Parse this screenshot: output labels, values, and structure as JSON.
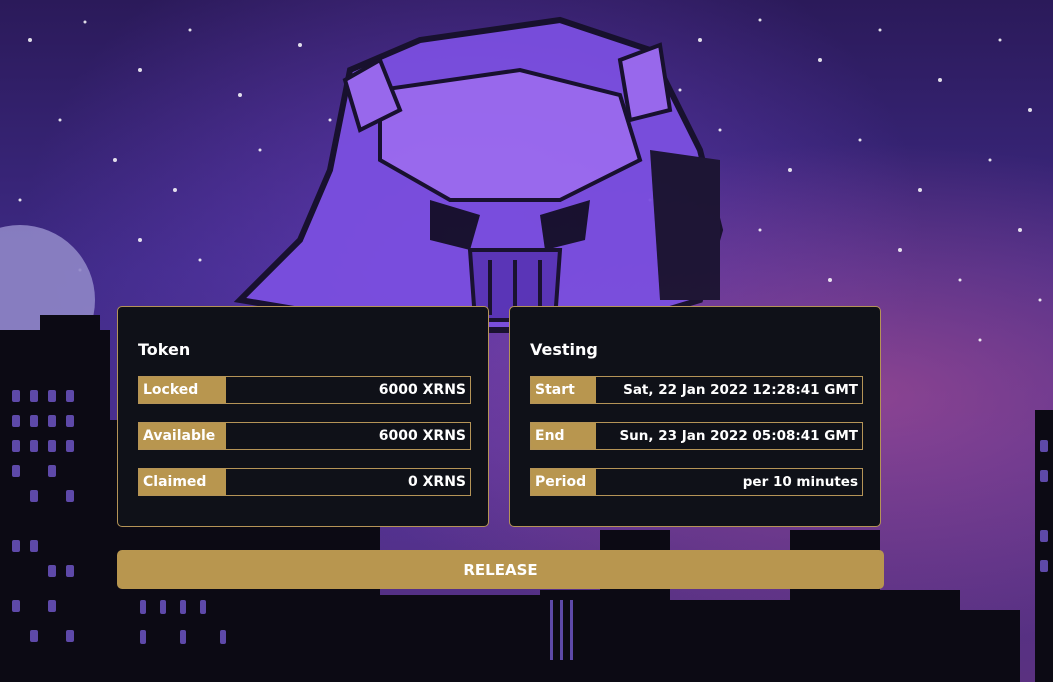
{
  "token": {
    "title": "Token",
    "rows": [
      {
        "label": "Locked",
        "value": "6000 XRNS"
      },
      {
        "label": "Available",
        "value": "6000 XRNS"
      },
      {
        "label": "Claimed",
        "value": "0 XRNS"
      }
    ]
  },
  "vesting": {
    "title": "Vesting",
    "rows": [
      {
        "label": "Start",
        "value": "Sat, 22 Jan 2022 12:28:41 GMT"
      },
      {
        "label": "End",
        "value": "Sun, 23 Jan 2022 05:08:41 GMT"
      },
      {
        "label": "Period",
        "value": "per 10 minutes"
      }
    ]
  },
  "actions": {
    "release_label": "RELEASE"
  },
  "colors": {
    "accent": "#b8964f",
    "panel_bg": "#0f1118",
    "text": "#ffffff"
  },
  "background": {
    "illustration": "robot-skull-helmet-over-city-night-sky",
    "moon": "moon-icon",
    "city": "city-skyline"
  }
}
